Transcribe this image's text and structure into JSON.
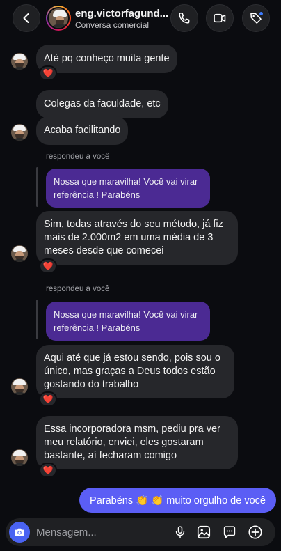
{
  "header": {
    "title": "eng.victorfagund...",
    "subtitle": "Conversa comercial"
  },
  "messages": [
    {
      "text": "Até pq conheço muita gente",
      "reaction": "❤️"
    },
    {
      "text": "Colegas da faculdade, etc"
    },
    {
      "text": "Acaba facilitando"
    },
    {
      "reply_label": "respondeu a você",
      "quote": "Nossa que maravilha! Você vai virar referência ! Parabéns",
      "text": "Sim, todas através do seu método, já fiz mais de 2.000m2 em uma média de 3 meses desde que comecei",
      "reaction": "❤️"
    },
    {
      "reply_label": "respondeu a você",
      "quote": "Nossa que maravilha! Você vai virar referência ! Parabéns",
      "text": "Aqui até que já estou sendo, pois sou o único, mas graças a Deus todos estão gostando do trabalho",
      "reaction": "❤️"
    },
    {
      "text": "Essa incorporadora msm, pediu pra ver meu relatório, enviei, eles gostaram bastante, aí fecharam comigo",
      "reaction": "❤️"
    }
  ],
  "sent": {
    "text": "Parabéns 👏 👏 muito orgulho de você"
  },
  "composer": {
    "placeholder": "Mensagem..."
  },
  "colors": {
    "background": "#0b0c10",
    "incoming_bubble": "#26272b",
    "quote_bubble": "#4b2a93",
    "outgoing_bubble": "#5b5ef5",
    "camera_button": "#4a63f2",
    "heart": "#e8324a"
  },
  "icons": {
    "back": "chevron-left-icon",
    "call": "phone-icon",
    "video": "video-camera-icon",
    "tag": "tag-icon",
    "camera": "camera-icon",
    "mic": "microphone-icon",
    "gallery": "image-icon",
    "sticker": "sticker-icon",
    "plus": "plus-icon"
  }
}
